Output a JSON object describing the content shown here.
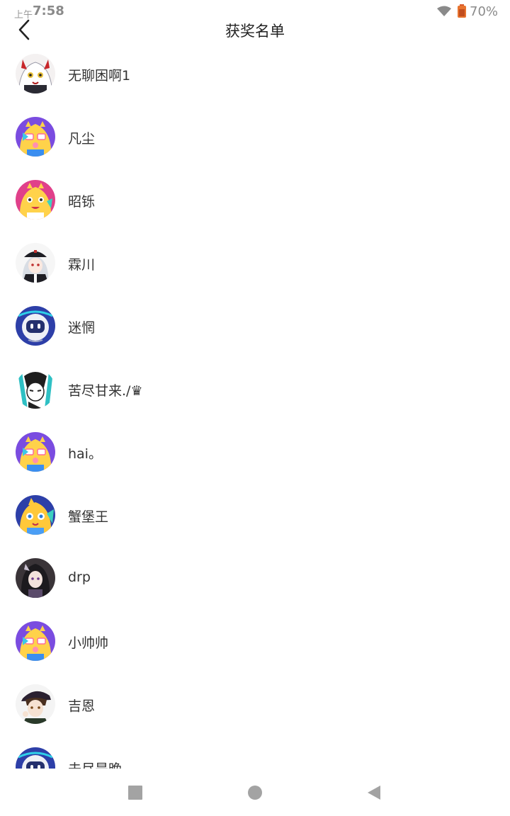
{
  "status_bar": {
    "time_prefix": "上午",
    "time": "7:58",
    "battery": "70%"
  },
  "header": {
    "title": "获奖名单"
  },
  "winners": [
    {
      "name": "无聊困啊1",
      "avatar": "anime-girl-white-hair-avatar"
    },
    {
      "name": "凡尘",
      "avatar": "yellow-mascot-purple-avatar"
    },
    {
      "name": "昭铄",
      "avatar": "yellow-mascot-pink-avatar"
    },
    {
      "name": "霖川",
      "avatar": "anime-girl-beret-avatar"
    },
    {
      "name": "迷惘",
      "avatar": "robot-blue-avatar"
    },
    {
      "name": "苦尽甘来./♛",
      "avatar": "miku-sketch-avatar"
    },
    {
      "name": "hai。",
      "avatar": "yellow-mascot-purple-avatar"
    },
    {
      "name": "蟹堡王",
      "avatar": "yellow-mascot-blue-avatar"
    },
    {
      "name": "drp",
      "avatar": "anime-girl-dark-avatar"
    },
    {
      "name": "小帅帅",
      "avatar": "yellow-mascot-purple-avatar"
    },
    {
      "name": "吉恩",
      "avatar": "anime-boy-hat-avatar"
    },
    {
      "name": "未尽是晚",
      "avatar": "robot-blue-avatar"
    }
  ],
  "colors": {
    "accent_purple": "#7a4ce0",
    "accent_pink": "#e0408a",
    "accent_blue": "#2d3fa8"
  },
  "nav_icons": [
    "recents-square-icon",
    "home-circle-icon",
    "back-triangle-icon"
  ]
}
